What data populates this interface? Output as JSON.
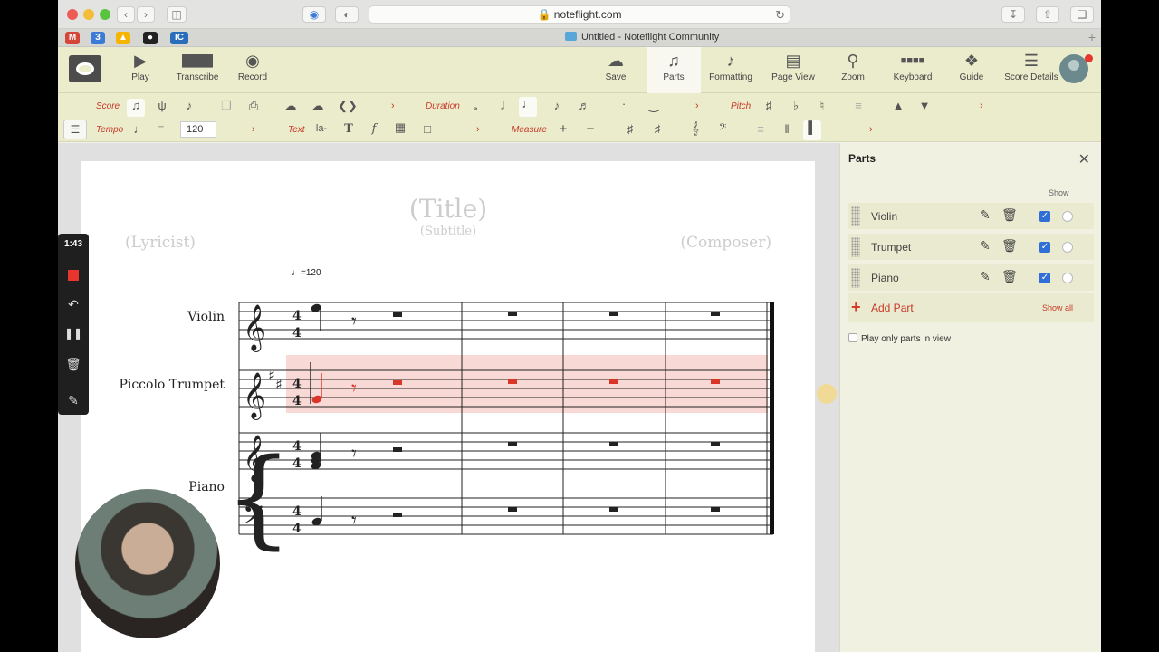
{
  "browser": {
    "url": "noteflight.com",
    "tab_title": "Untitled - Noteflight Community",
    "favicons": [
      "3",
      "IC"
    ]
  },
  "toolbar": {
    "items": [
      {
        "label": "Play",
        "icon": "play-icon"
      },
      {
        "label": "Transcribe",
        "icon": "keyboard-mic-icon"
      },
      {
        "label": "Record",
        "icon": "record-icon"
      },
      {
        "label": "Save",
        "icon": "cloud-upload-icon"
      },
      {
        "label": "Parts",
        "icon": "guitar-icon"
      },
      {
        "label": "Formatting",
        "icon": "music-page-icon"
      },
      {
        "label": "Page View",
        "icon": "page-icon"
      },
      {
        "label": "Zoom",
        "icon": "zoom-icon"
      },
      {
        "label": "Keyboard",
        "icon": "keyboard-icon"
      },
      {
        "label": "Guide",
        "icon": "compass-icon"
      },
      {
        "label": "Score Details",
        "icon": "list-icon"
      }
    ]
  },
  "palette": {
    "score_label": "Score",
    "duration_label": "Duration",
    "pitch_label": "Pitch",
    "tempo_label": "Tempo",
    "tempo_value": "120",
    "tempo_eq": "=",
    "text_label": "Text",
    "lyric_label": "la-",
    "measure_label": "Measure"
  },
  "score": {
    "title": "(Title)",
    "subtitle": "(Subtitle)",
    "lyricist": "(Lyricist)",
    "composer": "(Composer)",
    "tempo_mark": "=120",
    "instruments": [
      "Violin",
      "Piccolo Trumpet",
      "Piano"
    ]
  },
  "parts_panel": {
    "title": "Parts",
    "show_label": "Show",
    "parts": [
      "Violin",
      "Trumpet",
      "Piano"
    ],
    "add_part_label": "Add Part",
    "show_all_label": "Show all",
    "play_only_label": "Play only parts in view"
  },
  "recorder": {
    "time": "1:43"
  },
  "colors": {
    "accent": "#c73928",
    "toolbar_bg": "#ebeccc",
    "highlight": "#f8d9d5"
  }
}
